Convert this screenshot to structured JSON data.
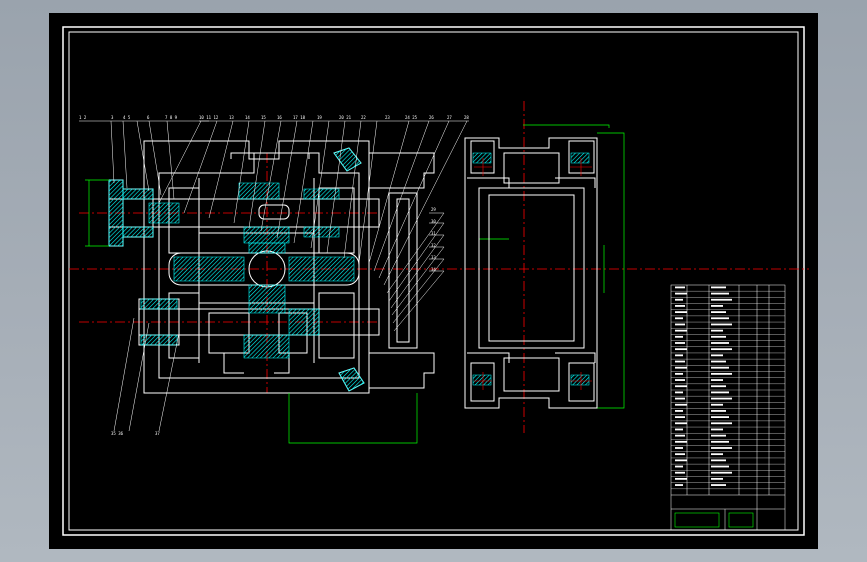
{
  "viewer": {
    "background": "#a4acb6",
    "sheet_color": "#000000"
  },
  "colors": {
    "outline": "#ffffff",
    "section_hatch": "#00ffff",
    "dimension": "#00ff00",
    "centerline": "#ff0000",
    "leader": "#ffffff"
  },
  "drawing": {
    "views": [
      "front-section-view",
      "side-view"
    ],
    "leader_label_count": 26,
    "title_block": {
      "bom_rows": 34
    }
  }
}
